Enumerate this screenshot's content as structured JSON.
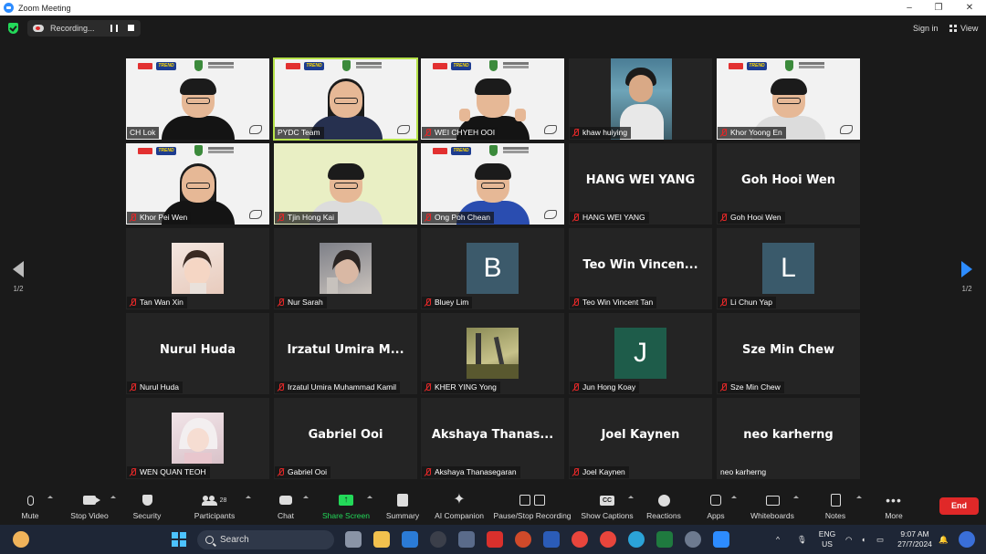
{
  "window": {
    "title": "Zoom Meeting",
    "controls": [
      "–",
      "❐",
      "✕"
    ]
  },
  "topbar": {
    "recording_label": "Recording...",
    "sign_in": "Sign in",
    "view": "View"
  },
  "pagination": {
    "left": "1/2",
    "right": "1/2"
  },
  "tiles": [
    {
      "name": "CH Lok",
      "kind": "video",
      "muted": false,
      "active": false
    },
    {
      "name": "PYDC Team",
      "kind": "video",
      "muted": false,
      "active": true
    },
    {
      "name": "WEI CHYEH OOI",
      "kind": "video",
      "muted": true,
      "active": false
    },
    {
      "name": "khaw huiying",
      "kind": "photo-video",
      "muted": true,
      "active": false
    },
    {
      "name": "Khor Yoong En",
      "kind": "video",
      "muted": true,
      "active": false
    },
    {
      "name": "Khor Pei Wen",
      "kind": "video",
      "muted": true,
      "active": false
    },
    {
      "name": "Tjin Hong Kai",
      "kind": "video",
      "muted": true,
      "active": false
    },
    {
      "name": "Ong Poh Chean",
      "kind": "video",
      "muted": true,
      "active": false
    },
    {
      "name": "HANG WEI YANG",
      "display": "HANG WEI YANG",
      "kind": "name",
      "muted": true
    },
    {
      "name": "Goh Hooi Wen",
      "display": "Goh Hooi Wen",
      "kind": "name",
      "muted": true
    },
    {
      "name": "Tan Wan Xin",
      "kind": "avatar-image",
      "muted": true
    },
    {
      "name": "Nur Sarah",
      "kind": "avatar-image",
      "muted": true
    },
    {
      "name": "Bluey Lim",
      "kind": "letter",
      "letter": "B",
      "color": "#3c5a6b",
      "muted": true
    },
    {
      "name": "Teo Win Vincent Tan",
      "display": "Teo Win Vincen...",
      "kind": "name",
      "muted": true
    },
    {
      "name": "Li Chun Yap",
      "kind": "letter",
      "letter": "L",
      "color": "#3a5a6b",
      "muted": true
    },
    {
      "name": "Nurul Huda",
      "display": "Nurul Huda",
      "kind": "name",
      "muted": true
    },
    {
      "name": "Irzatul Umira Muhammad Kamil",
      "display": "Irzatul Umira M...",
      "kind": "name",
      "muted": true
    },
    {
      "name": "KHER YING Yong",
      "kind": "avatar-image",
      "muted": true
    },
    {
      "name": "Jun Hong Koay",
      "kind": "letter",
      "letter": "J",
      "color": "#1e5c4a",
      "muted": true
    },
    {
      "name": "Sze Min Chew",
      "display": "Sze Min Chew",
      "kind": "name",
      "muted": true
    },
    {
      "name": "WEN QUAN TEOH",
      "kind": "avatar-image",
      "muted": true
    },
    {
      "name": "Gabriel Ooi",
      "display": "Gabriel Ooi",
      "kind": "name",
      "muted": true
    },
    {
      "name": "Akshaya Thanasegaran",
      "display": "Akshaya Thanas...",
      "kind": "name",
      "muted": true
    },
    {
      "name": "Joel Kaynen",
      "display": "Joel Kaynen",
      "kind": "name",
      "muted": true
    },
    {
      "name": "neo karherng",
      "display": "neo karherng",
      "kind": "name",
      "muted": false
    }
  ],
  "toolbar": {
    "mute": "Mute",
    "stop_video": "Stop Video",
    "security": "Security",
    "participants": "Participants",
    "participant_count": "28",
    "chat": "Chat",
    "share_screen": "Share Screen",
    "summary": "Summary",
    "ai_companion": "AI Companion",
    "recording": "Pause/Stop Recording",
    "captions": "Show Captions",
    "captions_icon": "CC",
    "reactions": "Reactions",
    "apps": "Apps",
    "whiteboards": "Whiteboards",
    "notes": "Notes",
    "more": "More",
    "end": "End"
  },
  "taskbar": {
    "search": "Search",
    "lang_top": "ENG",
    "lang_bottom": "US",
    "time": "9:07 AM",
    "date": "27/7/2024"
  },
  "colors": {
    "active_speaker": "#b6e34a",
    "share_green": "#23d959",
    "end_red": "#e02828",
    "accent_blue": "#2d8cff"
  }
}
